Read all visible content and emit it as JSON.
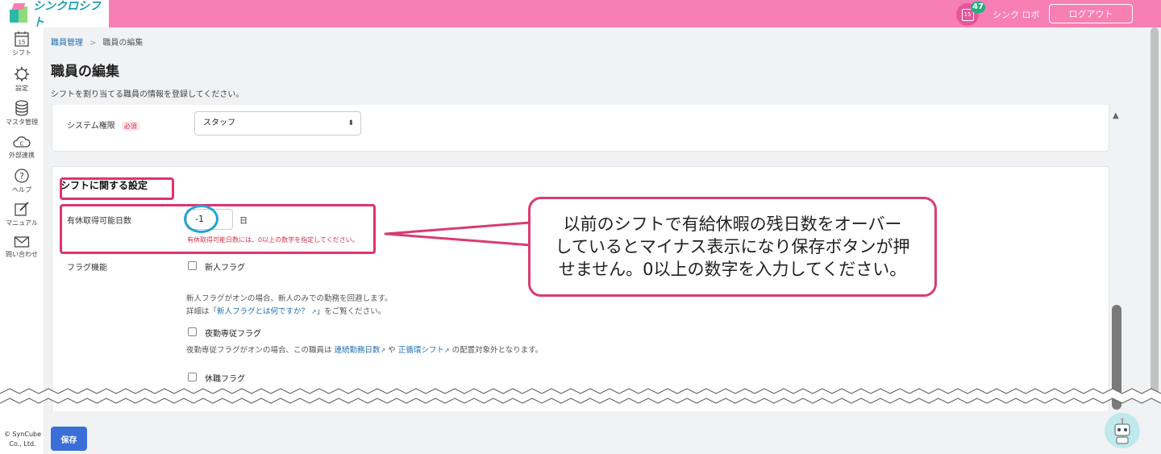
{
  "app": {
    "name": "シンクロシフト"
  },
  "header": {
    "notification_count": "47",
    "calendar_day": "15",
    "user_name": "シンク ロボ",
    "logout_label": "ログアウト"
  },
  "sidebar": {
    "items": [
      {
        "label": "シフト",
        "icon": "calendar-icon",
        "cal_day": "15"
      },
      {
        "label": "設定",
        "icon": "gear-icon"
      },
      {
        "label": "マスタ管理",
        "icon": "database-icon"
      },
      {
        "label": "外部連携",
        "icon": "cloud-icon"
      },
      {
        "label": "ヘルプ",
        "icon": "help-icon"
      },
      {
        "label": "マニュアル",
        "icon": "edit-icon"
      },
      {
        "label": "問い合わせ",
        "icon": "mail-icon"
      }
    ],
    "copyright_line1": "© SynCube",
    "copyright_line2": "Co., Ltd."
  },
  "breadcrumb": {
    "parent": "職員管理",
    "separator": ">",
    "current": "職員の編集"
  },
  "page": {
    "title": "職員の編集",
    "description": "シフトを割り当てる職員の情報を登録してください。"
  },
  "system_role": {
    "label": "システム権限",
    "required": "必須",
    "value": "スタッフ",
    "arrow": "⬍"
  },
  "shift_settings": {
    "heading": "シフトに関する設定",
    "paid_leave_label": "有休取得可能日数",
    "paid_leave_value": "-1",
    "paid_leave_unit": "日",
    "paid_leave_error": "有休取得可能日数には、0以上の数字を指定してください。",
    "flag_label": "フラグ機能",
    "new_flag_label": "新人フラグ",
    "new_flag_help1": "新人フラグがオンの場合、新人のみでの勤務を回避します。",
    "new_flag_help2_prefix": "詳細は「",
    "new_flag_help2_link": "新人フラグとは何ですか？",
    "new_flag_help2_suffix": "」をご覧ください。",
    "night_flag_label": "夜勤専従フラグ",
    "night_flag_help_prefix": "夜勤専従フラグがオンの場合、この職員は",
    "night_flag_help_link1": "連続勤務日数",
    "night_flag_help_mid": "や",
    "night_flag_help_link2": "正循環シフト",
    "night_flag_help_suffix": "の配置対象外となります。",
    "leave_flag_label": "休職フラグ"
  },
  "callout": {
    "line1": "以前のシフトで有給休暇の残日数をオーバー",
    "line2": "しているとマイナス表示になり保存ボタンが押",
    "line3": "せません。0以上の数字を入力してください。"
  },
  "save_label": "保存",
  "colors": {
    "header_pink": "#f77fb3",
    "highlight_pink": "#e0336f",
    "highlight_blue": "#22a3d8",
    "save_blue": "#3a6fd8",
    "error_red": "#d9304b",
    "badge_green": "#23b07d"
  }
}
